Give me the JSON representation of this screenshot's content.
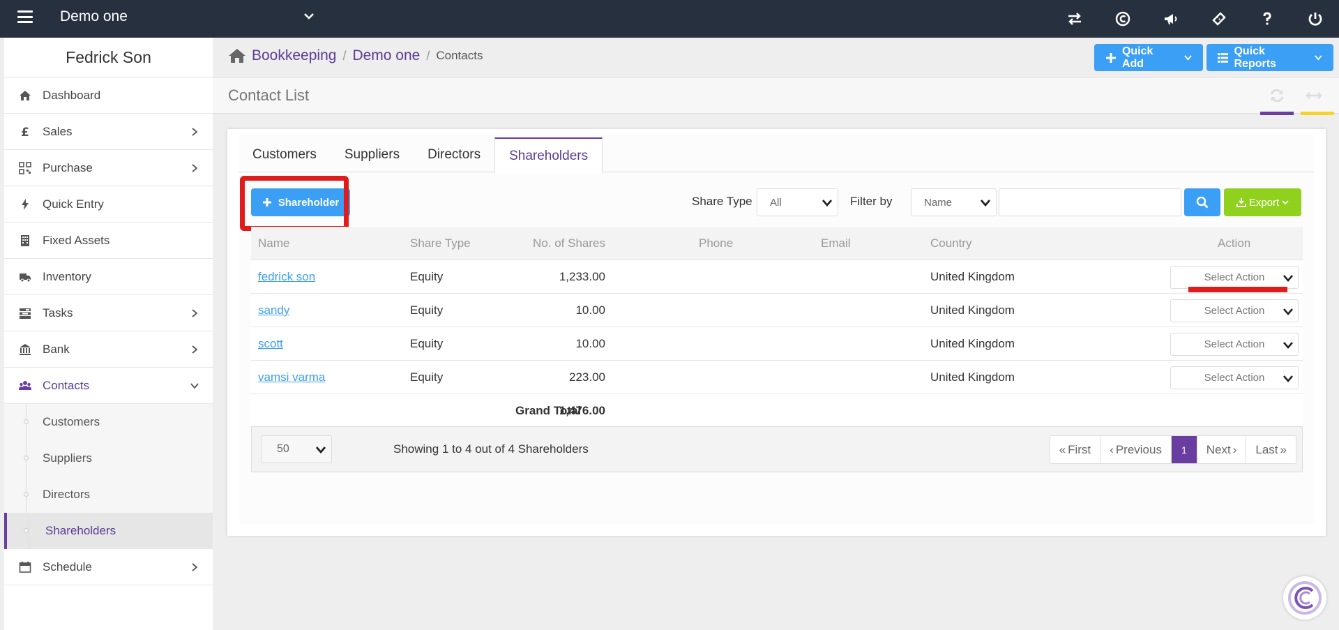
{
  "topbar": {
    "company_name": "Demo one",
    "icons": [
      "transfer-icon",
      "copyright-logo-icon",
      "megaphone-icon",
      "ticket-icon",
      "help-icon",
      "power-icon"
    ]
  },
  "sidebar": {
    "user_name": "Fedrick Son",
    "items": [
      {
        "label": "Dashboard",
        "icon": "home-icon"
      },
      {
        "label": "Sales",
        "icon": "pound-icon"
      },
      {
        "label": "Purchase",
        "icon": "barcode-icon"
      },
      {
        "label": "Quick Entry",
        "icon": "bolt-icon"
      },
      {
        "label": "Fixed Assets",
        "icon": "building-icon"
      },
      {
        "label": "Inventory",
        "icon": "truck-icon"
      },
      {
        "label": "Tasks",
        "icon": "tasks-icon"
      },
      {
        "label": "Bank",
        "icon": "bank-icon"
      },
      {
        "label": "Contacts",
        "icon": "users-icon"
      }
    ],
    "sub_items": [
      "Customers",
      "Suppliers",
      "Directors",
      "Shareholders"
    ],
    "schedule": {
      "label": "Schedule",
      "icon": "calendar-icon"
    }
  },
  "breadcrumb": {
    "items": [
      "Bookkeeping",
      "Demo one"
    ],
    "current": "Contacts"
  },
  "header_buttons": {
    "quick_add": "Quick Add",
    "quick_reports": "Quick Reports"
  },
  "page": {
    "title": "Contact List"
  },
  "tabs": [
    "Customers",
    "Suppliers",
    "Directors",
    "Shareholders"
  ],
  "toolbar": {
    "add_label": "Shareholder",
    "share_type_label": "Share Type",
    "share_type_value": "All",
    "filter_by_label": "Filter by",
    "filter_by_value": "Name",
    "search_value": "",
    "export_label": "Export"
  },
  "table": {
    "columns": [
      "Name",
      "Share Type",
      "No. of Shares",
      "Phone",
      "Email",
      "Country",
      "Action"
    ],
    "rows": [
      {
        "name": "fedrick son",
        "share_type": "Equity",
        "shares": "1,233.00",
        "phone": "",
        "email": "",
        "country": "United Kingdom",
        "action": "Select Action"
      },
      {
        "name": "sandy",
        "share_type": "Equity",
        "shares": "10.00",
        "phone": "",
        "email": "",
        "country": "United Kingdom",
        "action": "Select Action"
      },
      {
        "name": "scott",
        "share_type": "Equity",
        "shares": "10.00",
        "phone": "",
        "email": "",
        "country": "United Kingdom",
        "action": "Select Action"
      },
      {
        "name": "vamsi varma",
        "share_type": "Equity",
        "shares": "223.00",
        "phone": "",
        "email": "",
        "country": "United Kingdom",
        "action": "Select Action"
      }
    ],
    "total_label": "Grand Total",
    "total_value": "1,476.00"
  },
  "pagination": {
    "per_page": "50",
    "showing": "Showing 1 to 4 out of 4 Shareholders",
    "first": "First",
    "previous": "Previous",
    "current_page": "1",
    "next": "Next",
    "last": "Last"
  },
  "colors": {
    "topbar": "#27303e",
    "accent_purple": "#6a3ea1",
    "primary_blue": "#3a9ff5",
    "export_green": "#8fd11c",
    "highlight_red": "#e01b1b"
  }
}
